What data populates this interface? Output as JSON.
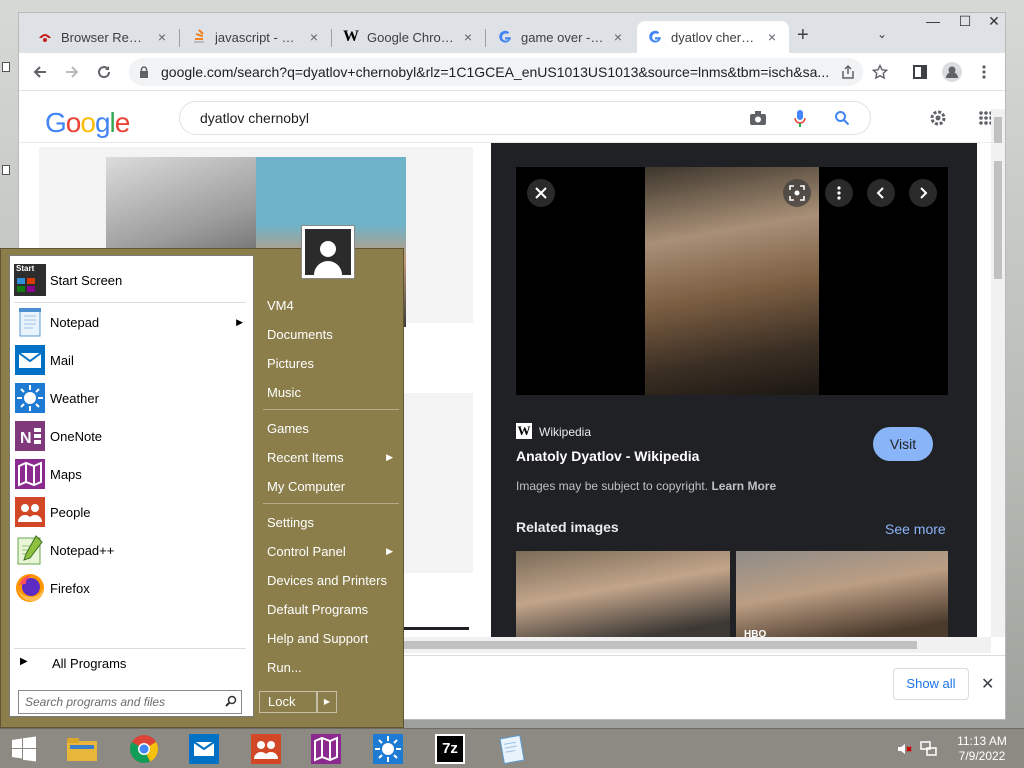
{
  "browser": {
    "tabs": [
      {
        "title": "Browser Reaper",
        "icon": "reaper-icon"
      },
      {
        "title": "javascript - How",
        "icon": "stackoverflow-icon"
      },
      {
        "title": "Google Chrome",
        "icon": "wikipedia-w-icon"
      },
      {
        "title": "game over - Go",
        "icon": "google-g-icon"
      },
      {
        "title": "dyatlov chernob",
        "icon": "google-g-icon",
        "active": true
      }
    ],
    "new_tab": "+",
    "tab_close": "×",
    "url": "google.com/search?q=dyatlov+chernobyl&rlz=1C1GCEA_enUS1013US1013&source=lnms&tbm=isch&sa...",
    "window_minimize": "—",
    "window_maximize": "☐",
    "window_close": "✕"
  },
  "google": {
    "logo": [
      "G",
      "o",
      "o",
      "g",
      "l",
      "e"
    ],
    "logo_colors": [
      "#4285F4",
      "#EA4335",
      "#FBBC05",
      "#4285F4",
      "#34A853",
      "#EA4335"
    ],
    "search_value": "dyatlov chernobyl"
  },
  "preview": {
    "source": "Wikipedia",
    "title": "Anatoly Dyatlov - Wikipedia",
    "visit": "Visit",
    "copyright": "Images may be subject to copyright.",
    "learn_more": "Learn More",
    "related": "Related images",
    "see_more": "See more",
    "hbo_badge": "HBO"
  },
  "downloads": {
    "show_all": "Show all",
    "close": "✕"
  },
  "start_menu": {
    "programs": [
      {
        "label": "Start Screen",
        "icon": "start-screen-icon"
      },
      {
        "label": "Notepad",
        "icon": "notepad-icon",
        "submenu": true
      },
      {
        "label": "Mail",
        "icon": "mail-icon"
      },
      {
        "label": "Weather",
        "icon": "weather-icon"
      },
      {
        "label": "OneNote",
        "icon": "onenote-icon"
      },
      {
        "label": "Maps",
        "icon": "maps-icon"
      },
      {
        "label": "People",
        "icon": "people-icon"
      },
      {
        "label": "Notepad++",
        "icon": "notepadpp-icon"
      },
      {
        "label": "Firefox",
        "icon": "firefox-icon"
      }
    ],
    "start_tile_text": "Start",
    "all_programs": "All Programs",
    "search_placeholder": "Search programs and files",
    "places": [
      {
        "label": "VM4"
      },
      {
        "label": "Documents"
      },
      {
        "label": "Pictures"
      },
      {
        "label": "Music"
      },
      {
        "label": "Games"
      },
      {
        "label": "Recent Items",
        "submenu": true
      },
      {
        "label": "My Computer"
      },
      {
        "label": "Settings"
      },
      {
        "label": "Control Panel",
        "submenu": true
      },
      {
        "label": "Devices and Printers"
      },
      {
        "label": "Default Programs"
      },
      {
        "label": "Help and Support"
      },
      {
        "label": "Run..."
      }
    ],
    "lock": "Lock"
  },
  "taskbar": {
    "apps": [
      "file-explorer-icon",
      "chrome-icon",
      "mail-icon",
      "people-icon",
      "maps-icon",
      "weather-icon",
      "7zip-icon",
      "notepad-icon"
    ],
    "sevenzip_label": "7z",
    "time": "11:13 AM",
    "date": "7/9/2022"
  }
}
